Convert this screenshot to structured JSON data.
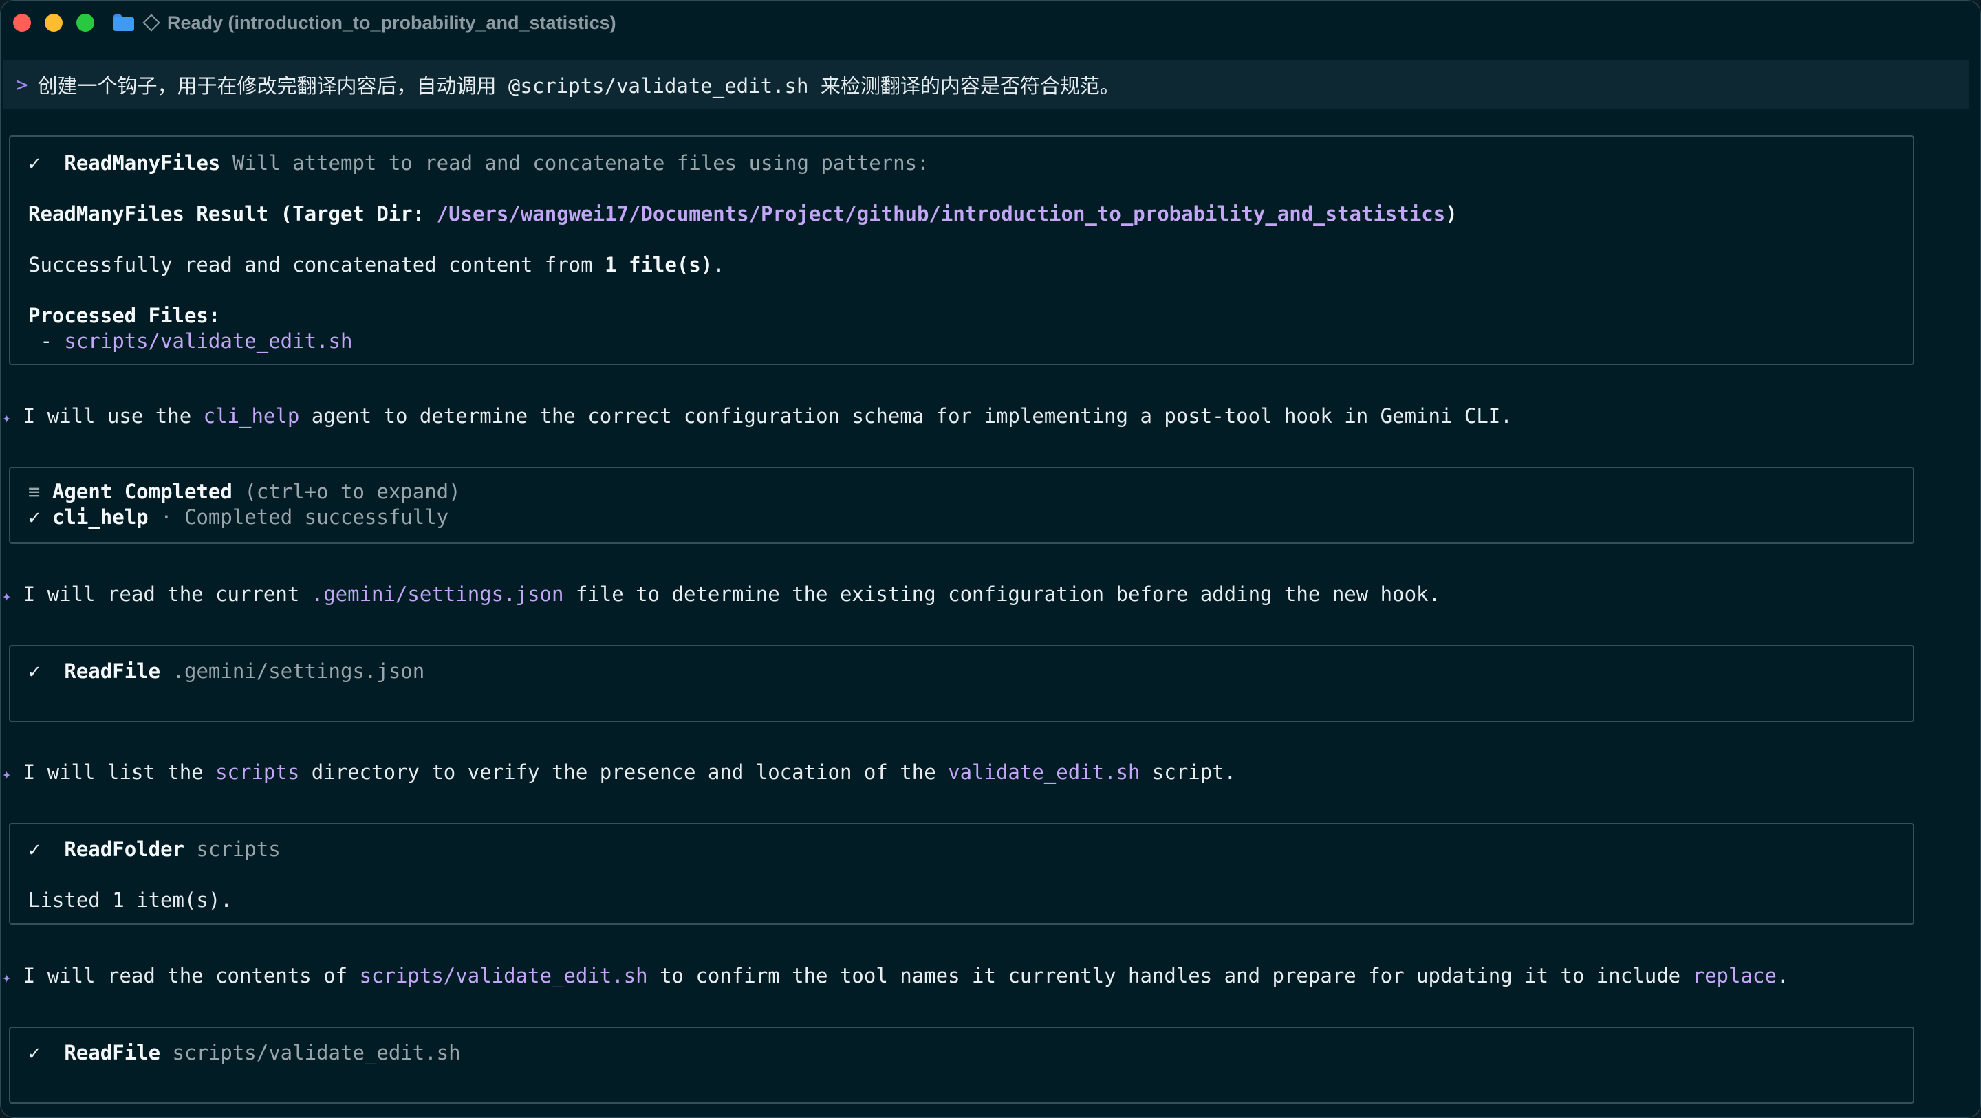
{
  "window": {
    "title": "Ready (introduction_to_probability_and_statistics)",
    "icons": [
      "folder-icon",
      "diamond-icon"
    ]
  },
  "prompt": {
    "caret": ">",
    "text": "创建一个钩子，用于在修改完翻译内容后，自动调用 @scripts/validate_edit.sh 来检测翻译的内容是否符合规范。"
  },
  "blocks": {
    "read_many": {
      "check": "✓",
      "tool": "ReadManyFiles",
      "desc": "Will attempt to read and concatenate files using patterns:",
      "result_prefix": "ReadManyFiles Result (Target Dir: ",
      "target_dir": "/Users/wangwei17/Documents/Project/github/introduction_to_probability_and_statistics",
      "result_suffix": ")",
      "success_prefix": "Successfully read and concatenated content from ",
      "success_count": "1 file(s)",
      "success_suffix": ".",
      "processed_label": "Processed Files:",
      "file_bullet": " - ",
      "file": "scripts/validate_edit.sh"
    },
    "msg1": {
      "star": "✦",
      "pre": "I will use the ",
      "hl": "cli_help",
      "post": " agent to determine the correct configuration schema for implementing a post-tool hook in Gemini CLI."
    },
    "agent": {
      "menu": "≡",
      "title": "Agent Completed",
      "hint": "(ctrl+o to expand)",
      "check": "✓",
      "name": "cli_help",
      "status": "· Completed successfully"
    },
    "msg2": {
      "star": "✦",
      "pre": "I will read the current ",
      "hl": ".gemini/settings.json",
      "post": " file to determine the existing configuration before adding the new hook."
    },
    "read_file1": {
      "check": "✓",
      "tool": "ReadFile",
      "arg": ".gemini/settings.json"
    },
    "msg3": {
      "star": "✦",
      "pre": "I will list the ",
      "hl1": "scripts",
      "mid": " directory to verify the presence and location of the ",
      "hl2": "validate_edit.sh",
      "post": " script."
    },
    "read_folder": {
      "check": "✓",
      "tool": "ReadFolder",
      "arg": "scripts",
      "result": "Listed 1 item(s)."
    },
    "msg4": {
      "star": "✦",
      "pre": "I will read the contents of ",
      "hl1": "scripts/validate_edit.sh",
      "mid": " to confirm the tool names it currently handles and prepare for updating it to include ",
      "hl2": "replace",
      "post": "."
    },
    "read_file2": {
      "check": "✓",
      "tool": "ReadFile",
      "arg": "scripts/validate_edit.sh"
    }
  }
}
